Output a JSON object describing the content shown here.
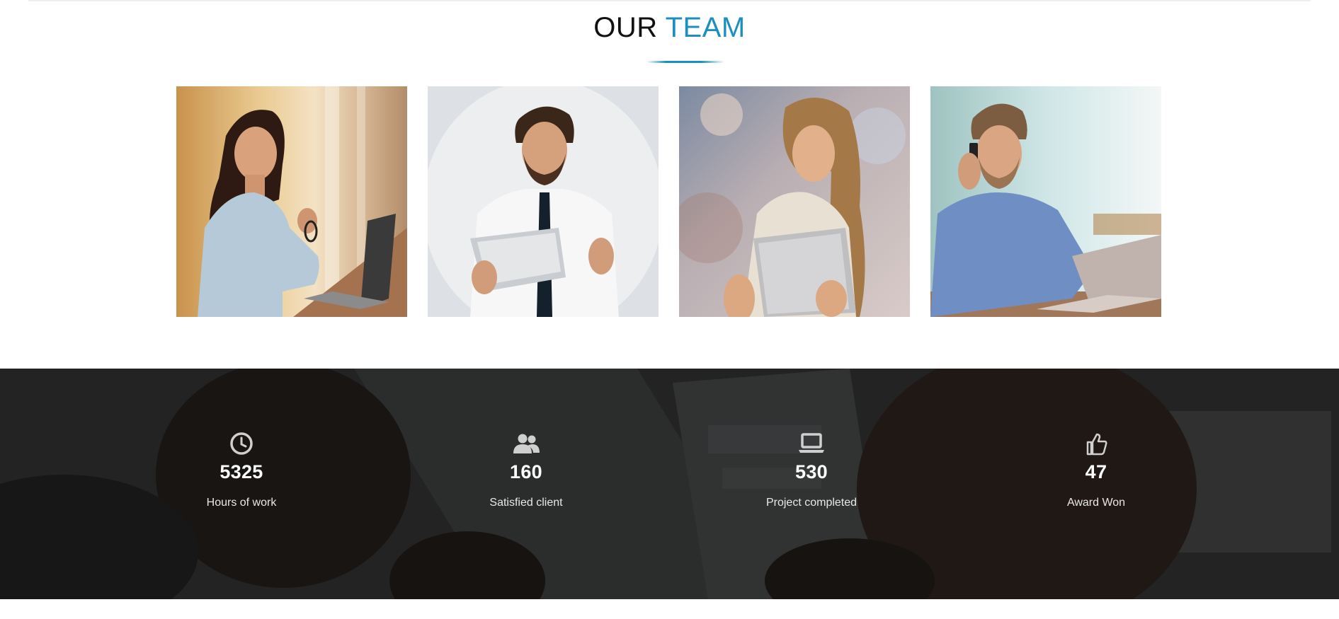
{
  "header": {
    "title_part1": "OUR",
    "title_part2": "TEAM",
    "accent_color": "#1c8fc0"
  },
  "team": {
    "members": [
      {
        "photo": "woman-with-glasses-and-laptop"
      },
      {
        "photo": "man-in-tie-with-tablet"
      },
      {
        "photo": "woman-with-tablet"
      },
      {
        "photo": "man-on-phone-with-laptop"
      }
    ]
  },
  "stats": [
    {
      "icon": "clock-icon",
      "value": "5325",
      "label": "Hours of work"
    },
    {
      "icon": "users-icon",
      "value": "160",
      "label": "Satisfied client"
    },
    {
      "icon": "laptop-icon",
      "value": "530",
      "label": "Project completed"
    },
    {
      "icon": "thumbs-up-icon",
      "value": "47",
      "label": "Award Won"
    }
  ]
}
